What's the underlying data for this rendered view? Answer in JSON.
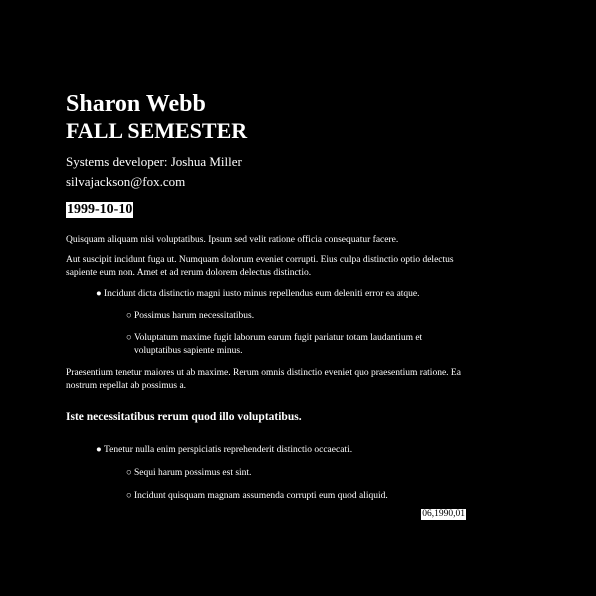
{
  "header": {
    "name": "Sharon Webb",
    "semester": "FALL SEMESTER",
    "developer": "Systems developer: Joshua Miller",
    "email": "silvajackson@fox.com"
  },
  "date": "1999-10-10",
  "body": {
    "para1": "Quisquam aliquam nisi voluptatibus. Ipsum sed velit ratione officia consequatur facere.",
    "para2": "Aut suscipit incidunt fuga ut. Numquam dolorum eveniet corrupti. Eius culpa distinctio optio delectus sapiente eum non. Amet et ad rerum dolorem delectus distinctio.",
    "list1": {
      "item": "Incidunt dicta distinctio magni iusto minus repellendus eum deleniti error ea atque.",
      "subitems": [
        "Possimus harum necessitatibus.",
        "Voluptatum maxime fugit laborum earum fugit pariatur totam laudantium et voluptatibus sapiente minus."
      ]
    },
    "para3": "Praesentium tenetur maiores ut ab maxime. Rerum omnis distinctio eveniet quo praesentium ratione. Ea nostrum repellat ab possimus a.",
    "section_heading": "Iste necessitatibus rerum quod illo voluptatibus.",
    "list2": {
      "item": "Tenetur nulla enim perspiciatis reprehenderit distinctio occaecati.",
      "subitems": [
        "Sequi harum possimus est sint.",
        "Incidunt quisquam magnam assumenda corrupti eum quod aliquid."
      ]
    },
    "code": "06,1990,01"
  },
  "icons": {
    "filled_bullet": "filled-circle-bullet",
    "hollow_bullet": "hollow-circle-bullet"
  },
  "colors": {
    "background": "#000000",
    "text": "#ffffff",
    "highlight_bg": "#ffffff",
    "highlight_text": "#000000"
  }
}
